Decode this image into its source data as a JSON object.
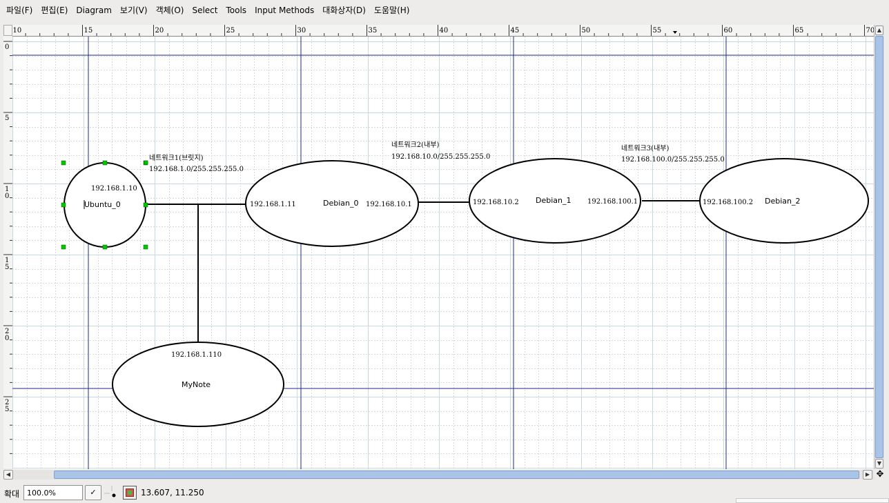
{
  "menubar": {
    "items": [
      "파일(F)",
      "편집(E)",
      "Diagram",
      "보기(V)",
      "객체(O)",
      "Select",
      "Tools",
      "Input Methods",
      "대화상자(D)",
      "도움말(H)"
    ]
  },
  "rulers": {
    "horizontal_labels": [
      "10",
      "15",
      "20",
      "25",
      "30",
      "35",
      "40",
      "45",
      "50",
      "55",
      "60",
      "65",
      "70"
    ],
    "vertical_labels": [
      "0",
      "5",
      "10",
      "15",
      "20",
      "25"
    ]
  },
  "diagram": {
    "nodes": [
      {
        "name": "Ubuntu_0",
        "ips": [
          "192.168.1.10"
        ],
        "selected": true
      },
      {
        "name": "Debian_0",
        "ips": [
          "192.168.1.11",
          "192.168.10.1"
        ],
        "selected": false
      },
      {
        "name": "Debian_1",
        "ips": [
          "192.168.10.2",
          "192.168.100.1"
        ],
        "selected": false
      },
      {
        "name": "Debian_2",
        "ips": [
          "192.168.100.2"
        ],
        "selected": false
      },
      {
        "name": "MyNote",
        "ips": [
          "192.168.1.110"
        ],
        "selected": false
      }
    ],
    "networks": [
      {
        "label": "네트워크1(브릿지)",
        "subnet": "192.168.1.0/255.255.255.0"
      },
      {
        "label": "네트워크2(내부)",
        "subnet": "192.168.10.0/255.255.255.0"
      },
      {
        "label": "네트워크3(내부)",
        "subnet": "192.168.100.0/255.255.255.0"
      }
    ]
  },
  "statusbar": {
    "zoom_label": "확대",
    "zoom_value": "100.0%",
    "coordinates": "13.607, 11.250"
  },
  "colors": {
    "guide": "#1c2a8c",
    "grid_major": "#c8d8e0",
    "grid_minor": "#d9d9d9",
    "handle": "#00c800",
    "scroll_thumb": "#a9c4e6"
  },
  "icons": {
    "zoom_dropdown": "chevron-down-icon",
    "snap_grid": "grid-icon",
    "snap_object": "snap-object-icon",
    "navigate": "move-icon"
  }
}
